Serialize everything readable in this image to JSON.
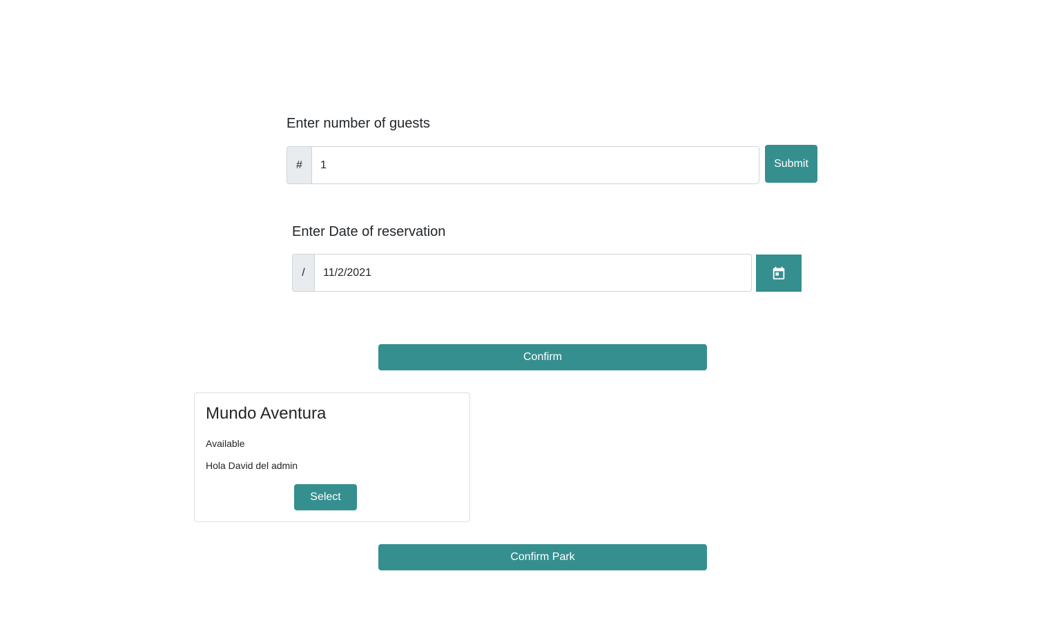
{
  "guests": {
    "label": "Enter number of guests",
    "prefix": "#",
    "value": "1",
    "submit_label": "Submit"
  },
  "reservation": {
    "label": "Enter Date of reservation",
    "prefix": "/",
    "value": "11/2/2021",
    "calendar_icon": "calendar-icon"
  },
  "confirm_label": "Confirm",
  "park_card": {
    "title": "Mundo Aventura",
    "status": "Available",
    "description": "Hola David del admin",
    "select_label": "Select"
  },
  "confirm_park_label": "Confirm Park",
  "colors": {
    "accent": "#368f8f",
    "addon_bg": "#e9ecef",
    "border": "#ced4da"
  }
}
